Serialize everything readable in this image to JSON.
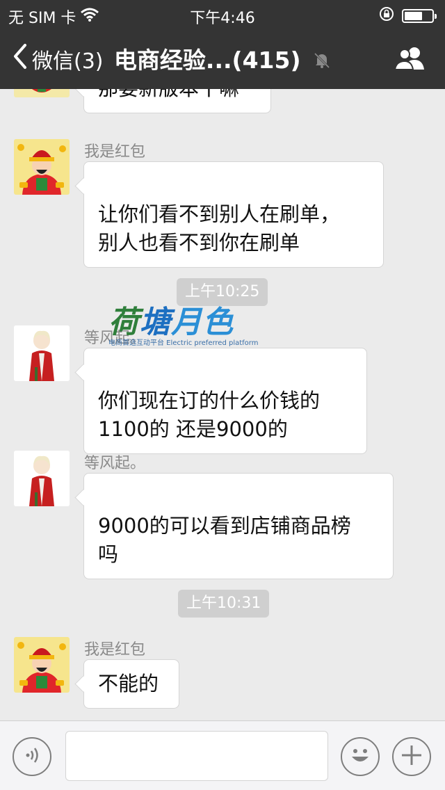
{
  "status_bar": {
    "carrier": "无 SIM 卡",
    "time": "下午4:46",
    "battery_level": 0.65
  },
  "nav": {
    "back_label": "微信(3)",
    "title": "电商经验...(415)",
    "icons": [
      "chevron-left-icon",
      "mute-bell-icon",
      "group-members-icon"
    ]
  },
  "messages": [
    {
      "text": "那要新版本干嘛"
    },
    {
      "sender": "我是红包",
      "text": "让你们看不到别人在刷单，\n别人也看不到你在刷单"
    },
    {
      "sender": "等风起。",
      "text": "你们现在订的什么价钱的\n1100的 还是9000的"
    },
    {
      "sender": "等风起。",
      "text": "9000的可以看到店铺商品榜\n吗"
    },
    {
      "sender": "我是红包",
      "text": "不能的"
    }
  ],
  "timestamps": [
    "上午10:25",
    "上午10:31"
  ],
  "watermark": {
    "title_chars": [
      "荷",
      "塘",
      "月",
      "色"
    ],
    "subtitle": "电商首选互动平台 Electric preferred platform"
  },
  "input_bar": {
    "icons": [
      "voice-icon",
      "emoji-icon",
      "plus-icon"
    ],
    "text_value": ""
  },
  "colors": {
    "top_bar": "#343434",
    "chat_background": "#ebebeb",
    "bubble": "#ffffff",
    "timestamp_pill": "#cfcfcf"
  }
}
